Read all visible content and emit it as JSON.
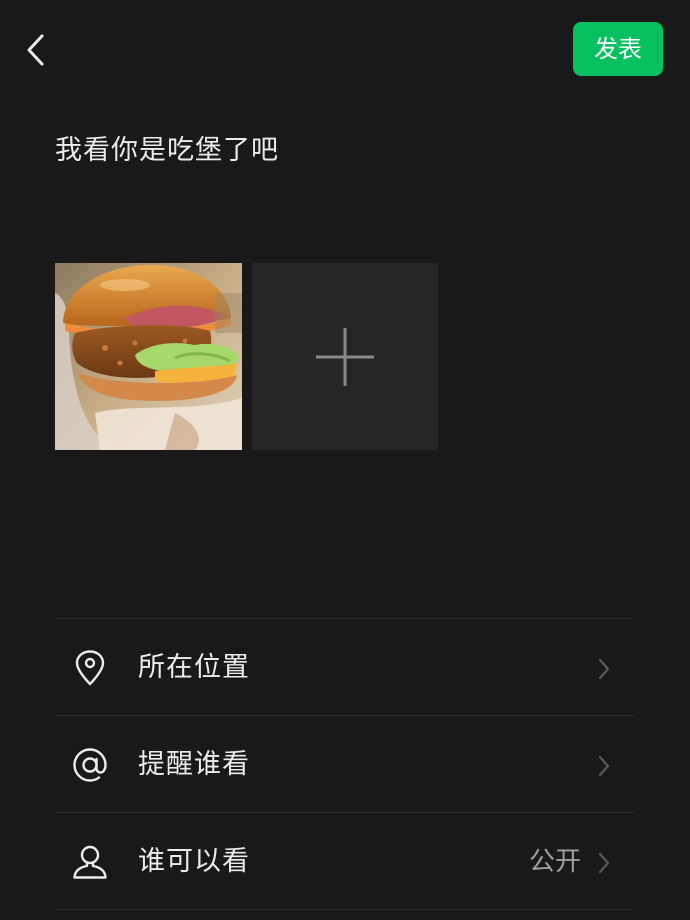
{
  "header": {
    "publish_label": "发表"
  },
  "post": {
    "text": "我看你是吃堡了吧"
  },
  "images": [
    {
      "alt": "burger photo"
    }
  ],
  "options": [
    {
      "label": "所在位置",
      "icon": "location-pin-icon",
      "value": ""
    },
    {
      "label": "提醒谁看",
      "icon": "at-sign-icon",
      "value": ""
    },
    {
      "label": "谁可以看",
      "icon": "person-icon",
      "value": "公开"
    }
  ],
  "colors": {
    "background": "#191919",
    "accent": "#07c160",
    "text": "#ececec",
    "secondary_text": "#a0a0a0",
    "tile": "#262626"
  }
}
